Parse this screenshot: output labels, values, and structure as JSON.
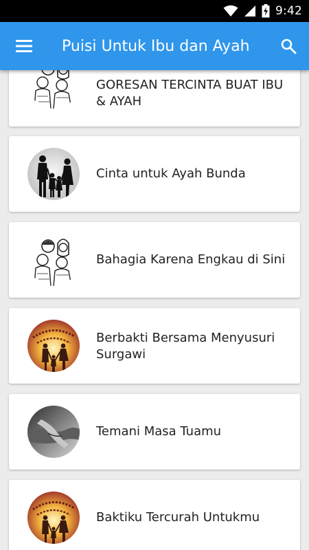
{
  "status": {
    "time": "9:42"
  },
  "app_bar": {
    "title": "Puisi Untuk Ibu dan Ayah"
  },
  "items": [
    {
      "label": "GORESAN TERCINTA BUAT IBU & AYAH",
      "thumb": "family-sketch-icon"
    },
    {
      "label": "Cinta untuk Ayah Bunda",
      "thumb": "family-silhouette-icon"
    },
    {
      "label": "Bahagia Karena Engkau di Sini",
      "thumb": "family-sketch-icon"
    },
    {
      "label": "Berbakti Bersama Menyusuri Surgawi",
      "thumb": "mothers-fathers-badge-icon"
    },
    {
      "label": "Temani Masa Tuamu",
      "thumb": "holding-hands-icon"
    },
    {
      "label": "Baktiku Tercurah Untukmu",
      "thumb": "mothers-fathers-badge-icon"
    }
  ],
  "colors": {
    "app_bar": "#2f96ec",
    "background": "#ececec",
    "card": "#ffffff"
  }
}
